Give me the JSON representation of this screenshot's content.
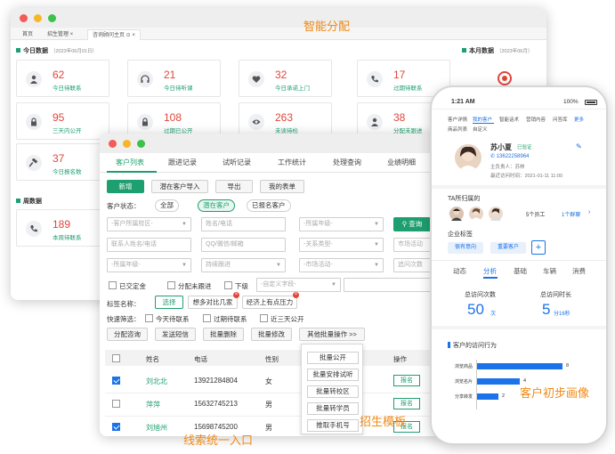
{
  "labels": {
    "smart_assign": "智能分配",
    "customer_profile": "客户初步画像",
    "enroll_template": "招生模板",
    "lead_entry": "线索统一入口"
  },
  "back_window": {
    "tabs": [
      {
        "label": "首页"
      },
      {
        "label": "招生管理 ×"
      },
      {
        "label": "咨询顾问主页 ⊙ ×"
      }
    ],
    "today_title": "今日数据",
    "today_date": "（2023年06月01日）",
    "month_title": "本月数据",
    "month_date": "（2023年06月）",
    "week_title": "周数据",
    "cards": [
      {
        "value": "62",
        "label": "今日待联系",
        "icon": "user-icon"
      },
      {
        "value": "21",
        "label": "今日待听课",
        "icon": "headset-icon"
      },
      {
        "value": "32",
        "label": "今日承诺上门",
        "icon": "heart-icon"
      },
      {
        "value": "17",
        "label": "过期待联系",
        "icon": "phone-icon"
      },
      {
        "value": "95",
        "label": "三天内公开",
        "icon": "lock-icon"
      },
      {
        "value": "108",
        "label": "过期已公开",
        "icon": "lock-icon"
      },
      {
        "value": "263",
        "label": "未读待检",
        "icon": "eye-icon"
      },
      {
        "value": "38",
        "label": "分配未跟进",
        "icon": "user-icon"
      },
      {
        "value": "37",
        "label": "今日报名数",
        "icon": "hammer-icon"
      }
    ],
    "week_card": {
      "value": "189",
      "label": "本周待联系",
      "icon": "phone-icon"
    }
  },
  "mid_window": {
    "tabs": [
      "客户列表",
      "跟进记录",
      "试听记录",
      "工作统计",
      "处理查询",
      "业绩明细"
    ],
    "toolbar": [
      "新增",
      "潜在客户导入",
      "导出",
      "我的表单"
    ],
    "status_label": "客户状态：",
    "status_chips": [
      "全部",
      "潜在客户",
      "已报名客户"
    ],
    "row1_inputs": [
      "-客户所属校区-",
      "姓名/电话",
      "-所属年级-"
    ],
    "search_label": "查询",
    "row2_inputs": [
      "联系人姓名/电话",
      "QQ/微信/邮箱",
      "-关系类型-",
      "市场活动"
    ],
    "row3_inputs": [
      "-所属年级-",
      "持续跟进",
      "-市场活动-",
      "追问次数"
    ],
    "checkbox_items": [
      "已交定金",
      "分配未跟进",
      "下级"
    ],
    "custom_field": "-自定义字段-",
    "tag_label": "标签名称：",
    "tag_choose": "选择",
    "tags": [
      "想多对比几家",
      "经济上有点压力"
    ],
    "quick_label": "快速筛选：",
    "quick_items": [
      "今天待联系",
      "过期待联系",
      "近三天公开"
    ],
    "actions": [
      "分配咨询",
      "发送短信",
      "批量删除",
      "批量修改",
      "其他批量操作 >>"
    ],
    "columns": [
      "姓名",
      "电话",
      "性别",
      "操作"
    ],
    "rows": [
      {
        "name": "刘北北",
        "phone": "13921284804",
        "gender": "女",
        "op": "报名",
        "checked": true
      },
      {
        "name": "萍萍",
        "phone": "15632745213",
        "gender": "男",
        "op": "报名",
        "checked": false
      },
      {
        "name": "刘旭州",
        "phone": "15698745200",
        "gender": "男",
        "op": "报名",
        "checked": true
      }
    ],
    "dropdown": [
      "批量公开",
      "批量安排试听",
      "批量转校区",
      "批量转学员",
      "推取手机号"
    ]
  },
  "phone": {
    "time": "1:21 AM",
    "battery": "100%",
    "tabs_row1": [
      "客户详情",
      "我的客户",
      "智能话术",
      "营销内容",
      "问答库",
      "更多"
    ],
    "tabs_row2": [
      "商品列表",
      "自定义"
    ],
    "name": "苏小夏",
    "badge": "已验证",
    "phone_no": "13622258964",
    "owner": "主负责人：苏林",
    "added": "最近访问时间：2021-01-11 11:00",
    "team_title": "TA所归属的",
    "team_members": "5个员工",
    "team_groups": "1个群聊",
    "biz_tags_title": "企业标签",
    "biz_tags": [
      "很有意向",
      "重要客户"
    ],
    "sub_tabs": [
      "动态",
      "分析",
      "基础",
      "车辆",
      "消费"
    ],
    "visits_label": "总访问次数",
    "visits_value": "50",
    "visits_unit": "次",
    "duration_label": "总访问时长",
    "duration_value": "5",
    "duration_unit": "分16秒",
    "behavior_title": "客户的访问行为"
  },
  "chart_data": {
    "type": "bar",
    "orientation": "horizontal",
    "title": "客户的访问行为",
    "categories": [
      "浏览商品",
      "浏览名片",
      "分享转发"
    ],
    "values": [
      8,
      4,
      2
    ],
    "xlim": [
      0,
      10
    ],
    "color": "#1a73e8"
  }
}
